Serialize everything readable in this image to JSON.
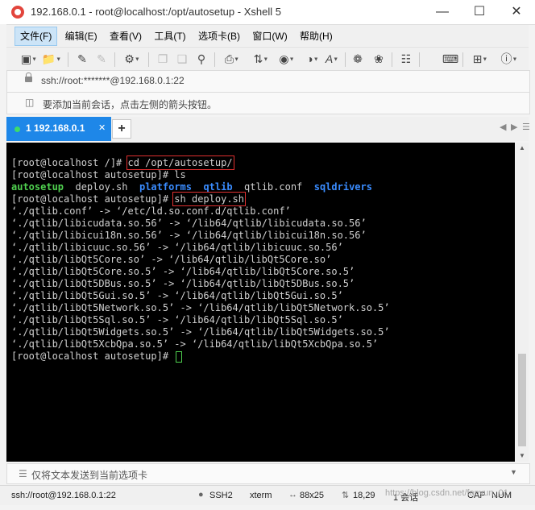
{
  "window": {
    "title": "192.168.0.1 - root@localhost:/opt/autosetup - Xshell 5",
    "controls": [
      "minimize",
      "maximize",
      "close"
    ]
  },
  "menu": {
    "items": [
      "文件(F)",
      "编辑(E)",
      "查看(V)",
      "工具(T)",
      "选项卡(B)",
      "窗口(W)",
      "帮助(H)"
    ]
  },
  "address": {
    "value": "ssh://root:*******@192.168.0.1:22"
  },
  "hint": {
    "text": "要添加当前会话，点击左侧的箭头按钮。"
  },
  "tabs": {
    "items": [
      {
        "label": "1 192.168.0.1"
      }
    ],
    "add_label": "+"
  },
  "terminal": {
    "l1_prompt": "[root@localhost /]# ",
    "l1_cmd": "cd /opt/autosetup/",
    "l2": "[root@localhost autosetup]# ls",
    "ls_autosetup": "autosetup",
    "ls_deploy": "deploy.sh",
    "ls_platforms": "platforms",
    "ls_qtlib": "qtlib",
    "ls_qtlibconf": "qtlib.conf",
    "ls_sqldrivers": "sqldrivers",
    "l4_prompt": "[root@localhost autosetup]# ",
    "l4_cmd": "sh deploy.sh",
    "output": [
      "‘./qtlib.conf’ -> ‘/etc/ld.so.conf.d/qtlib.conf’",
      "‘./qtlib/libicudata.so.56’ -> ‘/lib64/qtlib/libicudata.so.56’",
      "‘./qtlib/libicui18n.so.56’ -> ‘/lib64/qtlib/libicui18n.so.56’",
      "‘./qtlib/libicuuc.so.56’ -> ‘/lib64/qtlib/libicuuc.so.56’",
      "‘./qtlib/libQt5Core.so’ -> ‘/lib64/qtlib/libQt5Core.so’",
      "‘./qtlib/libQt5Core.so.5’ -> ‘/lib64/qtlib/libQt5Core.so.5’",
      "‘./qtlib/libQt5DBus.so.5’ -> ‘/lib64/qtlib/libQt5DBus.so.5’",
      "‘./qtlib/libQt5Gui.so.5’ -> ‘/lib64/qtlib/libQt5Gui.so.5’",
      "‘./qtlib/libQt5Network.so.5’ -> ‘/lib64/qtlib/libQt5Network.so.5’",
      "‘./qtlib/libQt5Sql.so.5’ -> ‘/lib64/qtlib/libQt5Sql.so.5’",
      "‘./qtlib/libQt5Widgets.so.5’ -> ‘/lib64/qtlib/libQt5Widgets.so.5’",
      "‘./qtlib/libQt5XcbQpa.so.5’ -> ‘/lib64/qtlib/libQt5XcbQpa.so.5’"
    ],
    "last_prompt": "[root@localhost autosetup]# "
  },
  "compose": {
    "text": "仅将文本发送到当前选项卡"
  },
  "status": {
    "connection": "ssh://root@192.168.0.1:22",
    "protocol": "SSH2",
    "terminal_type": "xterm",
    "size": "88x25",
    "cursor_pos": "18,29",
    "sessions": "1 会话",
    "caps": "CAP",
    "num": "NUM"
  },
  "watermark": "https://blog.csdn.net/fanyun_01",
  "colors": {
    "tab_active": "#1e87e8",
    "terminal_bg": "#000000",
    "dir": "#3a8cff",
    "exe": "#4fd04f",
    "highlight_box": "#e03030"
  }
}
